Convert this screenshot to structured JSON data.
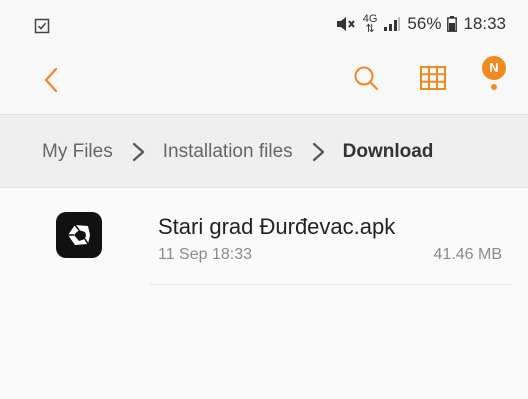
{
  "status_bar": {
    "network_top": "4G",
    "network_bottom": "⇅",
    "battery_percent": "56%",
    "time": "18:33"
  },
  "toolbar": {
    "back_icon": "chevron-left-icon",
    "search_icon": "search-icon",
    "grid_icon": "grid-view-icon",
    "notification_badge": "N",
    "accent_color": "#f08a1e"
  },
  "breadcrumb": {
    "items": [
      "My Files",
      "Installation files",
      "Download"
    ]
  },
  "files": [
    {
      "name": "Stari grad Đurđevac.apk",
      "date": "11 Sep 18:33",
      "size": "41.46 MB",
      "icon": "unity-app-icon"
    }
  ]
}
